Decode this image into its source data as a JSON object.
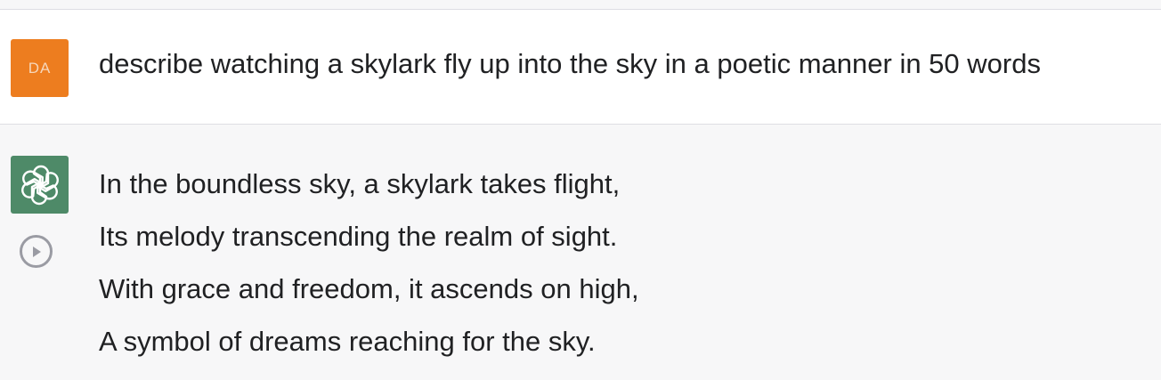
{
  "user_message": {
    "avatar_initials": "DA",
    "avatar_color": "#ed7d1f",
    "text": "describe watching a skylark fly up into the sky in a poetic manner in 50 words"
  },
  "assistant_message": {
    "avatar_icon": "openai-logo-icon",
    "avatar_color": "#4e8a68",
    "play_icon": "play-circle-icon",
    "lines": [
      "In the boundless sky, a skylark takes flight,",
      "Its melody transcending the realm of sight.",
      "With grace and freedom, it ascends on high,",
      "A symbol of dreams reaching for the sky."
    ]
  }
}
